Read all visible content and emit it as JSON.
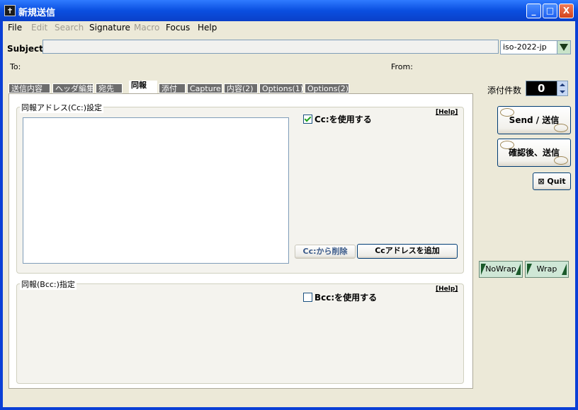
{
  "window": {
    "title": "新規送信",
    "minimize": "_",
    "maximize": "□",
    "close": "X"
  },
  "menu": {
    "items": [
      {
        "label": "File",
        "enabled": true
      },
      {
        "label": "Edit",
        "enabled": false
      },
      {
        "label": "Search",
        "enabled": false
      },
      {
        "label": "Signature",
        "enabled": true
      },
      {
        "label": "Macro",
        "enabled": false
      },
      {
        "label": "Focus",
        "enabled": true
      },
      {
        "label": "Help",
        "enabled": true
      }
    ]
  },
  "header": {
    "subject_label": "Subject",
    "subject_value": "",
    "charset": "iso-2022-jp",
    "to_label": "To:",
    "from_label": "From:"
  },
  "tabs": [
    {
      "label": "送信内容"
    },
    {
      "label": "ヘッダ編集"
    },
    {
      "label": "宛先"
    },
    {
      "label": "同報",
      "active": true
    },
    {
      "label": "添付"
    },
    {
      "label": "Capture"
    },
    {
      "label": "内容(2)"
    },
    {
      "label": "Options(1)"
    },
    {
      "label": "Options(2)"
    }
  ],
  "cc_group": {
    "title": "同報アドレス(Cc:)設定",
    "help": "[Help]",
    "use_cc_label": "Cc:を使用する",
    "use_cc_checked": true,
    "remove_button": "Cc:から削除",
    "add_button": "Ccアドレスを追加"
  },
  "bcc_group": {
    "title": "同報(Bcc:)指定",
    "help": "[Help]",
    "use_bcc_label": "Bcc:を使用する",
    "use_bcc_checked": false
  },
  "side": {
    "attach_count_label": "添付件数",
    "attach_count": "0",
    "send_button": "Send / 送信",
    "confirm_send_button": "確認後、送信",
    "quit_button": "⊠ Quit",
    "nowrap_button": "NoWrap",
    "wrap_button": "Wrap"
  }
}
